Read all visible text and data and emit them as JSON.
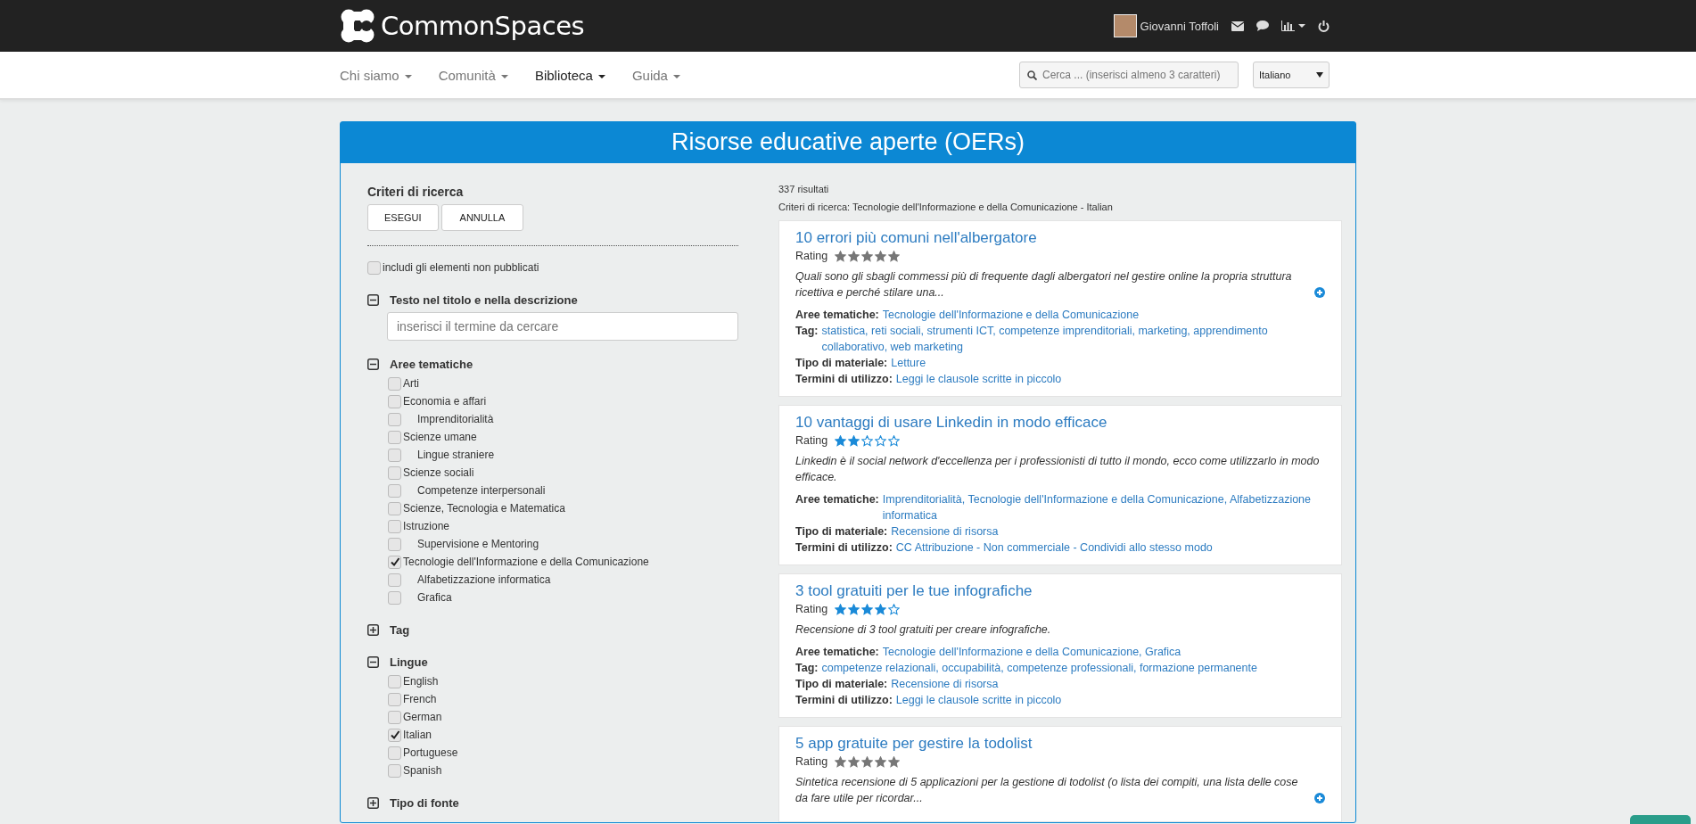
{
  "brand": {
    "name": "CommonSpaces"
  },
  "user": {
    "name": "Giovanni Toffoli"
  },
  "nav": {
    "items": [
      {
        "label": "Chi siamo",
        "selected": false
      },
      {
        "label": "Comunità",
        "selected": false
      },
      {
        "label": "Biblioteca",
        "selected": true
      },
      {
        "label": "Guida",
        "selected": false
      }
    ],
    "search": {
      "placeholder": "Cerca ... (inserisci almeno 3 caratteri)"
    },
    "language": {
      "value": "Italiano"
    }
  },
  "panel": {
    "title": "Risorse educative aperte (OERs)"
  },
  "filters": {
    "title": "Criteri di ricerca",
    "buttons": [
      "ESEGUI",
      "ANNULLA"
    ],
    "unpublished": {
      "label": "includi gli elementi non pubblicati",
      "checked": false
    },
    "sections": [
      {
        "kind": "text",
        "title": "Testo nel titolo e nella descrizione",
        "expanded": true,
        "placeholder": "inserisci il termine da cercare"
      },
      {
        "kind": "checklist",
        "title": "Aree tematiche",
        "expanded": true,
        "items": [
          {
            "label": "Arti",
            "checked": false
          },
          {
            "label": "Economia e affari",
            "checked": false,
            "children": [
              {
                "label": "Imprenditorialità",
                "checked": false
              }
            ]
          },
          {
            "label": "Scienze umane",
            "checked": false,
            "children": [
              {
                "label": "Lingue straniere",
                "checked": false
              }
            ]
          },
          {
            "label": "Scienze sociali",
            "checked": false,
            "children": [
              {
                "label": "Competenze interpersonali",
                "checked": false
              }
            ]
          },
          {
            "label": "Scienze, Tecnologia e Matematica",
            "checked": false
          },
          {
            "label": "Istruzione",
            "checked": false,
            "children": [
              {
                "label": "Supervisione e Mentoring",
                "checked": false
              }
            ]
          },
          {
            "label": "Tecnologie dell'Informazione e della Comunicazione",
            "checked": true,
            "children": [
              {
                "label": "Alfabetizzazione informatica",
                "checked": false
              },
              {
                "label": "Grafica",
                "checked": false
              }
            ]
          }
        ]
      },
      {
        "title": "Tag",
        "expanded": false
      },
      {
        "kind": "checklist",
        "title": "Lingue",
        "expanded": true,
        "items": [
          {
            "label": "English",
            "checked": false
          },
          {
            "label": "French",
            "checked": false
          },
          {
            "label": "German",
            "checked": false
          },
          {
            "label": "Italian",
            "checked": true
          },
          {
            "label": "Portuguese",
            "checked": false
          },
          {
            "label": "Spanish",
            "checked": false
          }
        ]
      },
      {
        "title": "Tipo di fonte",
        "expanded": false
      }
    ]
  },
  "results": {
    "count": "337 risultati",
    "criteria": "Criteri di ricerca: Tecnologie dell'Informazione e della Comunicazione - Italian",
    "items": [
      {
        "title": "10 errori più comuni nell'albergatore",
        "rating_label": "Rating",
        "rated": false,
        "description": "Quali sono gli sbagli commessi più di frequente dagli albergatori nel gestire online la propria struttura ricettiva e perché stilare una...",
        "more": true,
        "fields": [
          {
            "label": "Aree tematiche:",
            "value": "Tecnologie dell'Informazione e della Comunicazione"
          },
          {
            "label": "Tag:",
            "value": "statistica, reti sociali, strumenti ICT, competenze imprenditoriali, marketing, apprendimento collaborativo, web marketing"
          },
          {
            "label": "Tipo di materiale:",
            "value": "Letture"
          },
          {
            "label": "Termini di utilizzo:",
            "value": "Leggi le clausole scritte in piccolo"
          }
        ]
      },
      {
        "title": "10 vantaggi di usare Linkedin in modo efficace",
        "rating_label": "Rating",
        "rated": true,
        "stars": 2,
        "description": "Linkedin è il social network d'eccellenza per i professionisti di tutto il mondo, ecco come utilizzarlo in modo efficace.",
        "more": false,
        "fields": [
          {
            "label": "Aree tematiche:",
            "value": "Imprenditorialità, Tecnologie dell'Informazione e della Comunicazione, Alfabetizzazione informatica"
          },
          {
            "label": "Tipo di materiale:",
            "value": "Recensione di risorsa"
          },
          {
            "label": "Termini di utilizzo:",
            "value": "CC Attribuzione - Non commerciale - Condividi allo stesso modo"
          }
        ]
      },
      {
        "title": "3 tool gratuiti per le tue infografiche",
        "rating_label": "Rating",
        "rated": true,
        "stars": 4,
        "description": "Recensione di 3 tool gratuiti per creare infografiche.",
        "more": false,
        "fields": [
          {
            "label": "Aree tematiche:",
            "value": "Tecnologie dell'Informazione e della Comunicazione, Grafica"
          },
          {
            "label": "Tag:",
            "value": "competenze relazionali, occupabilità, competenze professionali, formazione permanente"
          },
          {
            "label": "Tipo di materiale:",
            "value": "Recensione di risorsa"
          },
          {
            "label": "Termini di utilizzo:",
            "value": "Leggi le clausole scritte in piccolo"
          }
        ]
      },
      {
        "title": "5 app gratuite per gestire la todolist",
        "rating_label": "Rating",
        "rated": false,
        "description": "Sintetica recensione di 5 applicazioni per la gestione di todolist (o lista dei compiti, una lista delle cose da fare utile per ricordar...",
        "more": true
      }
    ]
  }
}
